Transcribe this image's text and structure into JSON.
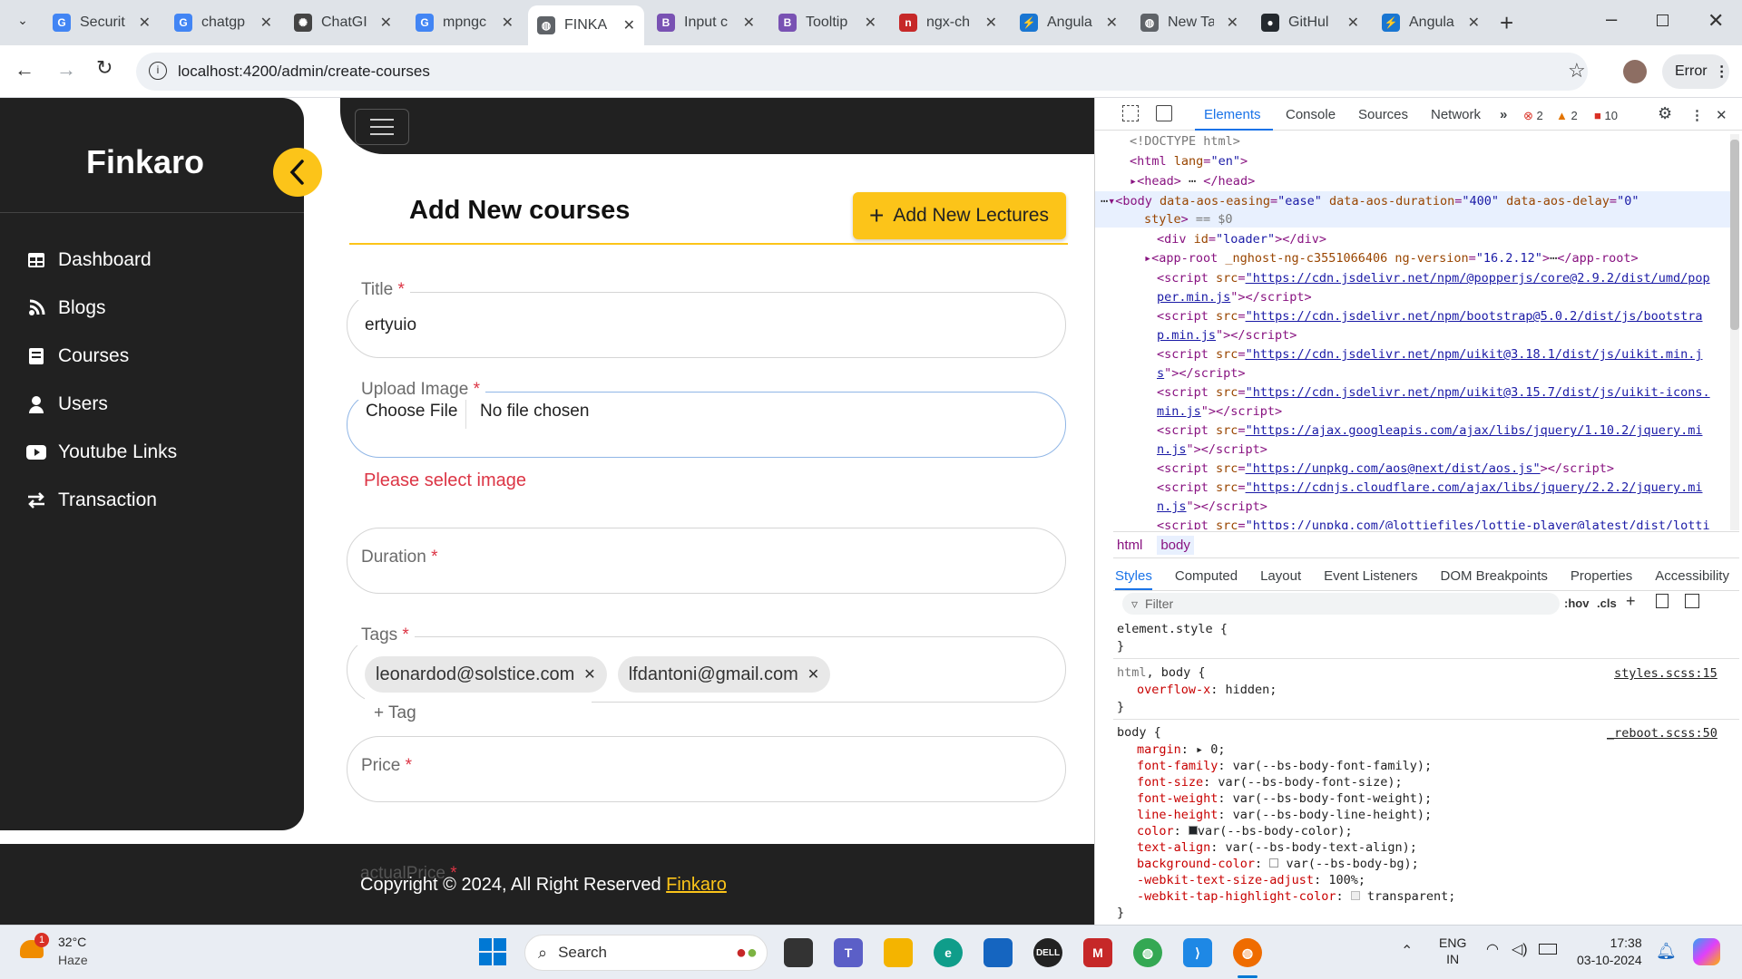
{
  "browser": {
    "tabs": [
      {
        "label": "Securit",
        "fav": "G",
        "color": "#4285f4",
        "active": false
      },
      {
        "label": "chatgp",
        "fav": "G",
        "color": "#4285f4",
        "active": false
      },
      {
        "label": "ChatGI",
        "fav": "✺",
        "color": "#444",
        "active": false
      },
      {
        "label": "mpngc",
        "fav": "G",
        "color": "#4285f4",
        "active": false
      },
      {
        "label": "FINKA",
        "fav": "◍",
        "color": "#5f6368",
        "active": true
      },
      {
        "label": "Input c",
        "fav": "B",
        "color": "#7952b3",
        "active": false
      },
      {
        "label": "Tooltip",
        "fav": "B",
        "color": "#7952b3",
        "active": false
      },
      {
        "label": "ngx-ch",
        "fav": "n",
        "color": "#c62828",
        "active": false
      },
      {
        "label": "Angula",
        "fav": "⚡",
        "color": "#1976d2",
        "active": false
      },
      {
        "label": "New Ta",
        "fav": "◍",
        "color": "#5f6368",
        "active": false
      },
      {
        "label": "GitHul",
        "fav": "●",
        "color": "#24292e",
        "active": false
      },
      {
        "label": "Angula",
        "fav": "⚡",
        "color": "#1976d2",
        "active": false
      }
    ],
    "url": "localhost:4200/admin/create-courses",
    "profile_label": "Error",
    "icons": [
      "tab-search-icon",
      "back-icon",
      "forward-icon",
      "reload-icon",
      "site-info-icon",
      "bookmark-star-icon",
      "avatar",
      "kebab-menu-icon",
      "new-tab-icon",
      "minimize-icon",
      "maximize-icon",
      "close-window-icon"
    ]
  },
  "sidebar": {
    "brand": "Finkaro",
    "items": [
      {
        "label": "Dashboard",
        "icon": "dashboard-icon"
      },
      {
        "label": "Blogs",
        "icon": "blogs-icon"
      },
      {
        "label": "Courses",
        "icon": "courses-icon"
      },
      {
        "label": "Users",
        "icon": "users-icon"
      },
      {
        "label": "Youtube Links",
        "icon": "youtube-icon"
      },
      {
        "label": "Transaction",
        "icon": "transaction-icon"
      }
    ]
  },
  "main": {
    "page_title": "Add New courses",
    "add_lectures_label": "Add New Lectures",
    "fields": {
      "title": {
        "label": "Title",
        "required": "*",
        "value": "ertyuio"
      },
      "upload": {
        "label": "Upload Image",
        "required": "*",
        "button": "Choose File",
        "status": "No file chosen",
        "error": "Please select image"
      },
      "duration": {
        "label": "Duration",
        "required": "*"
      },
      "tags": {
        "label": "Tags",
        "required": "*",
        "chips": [
          "leonardod@solstice.com",
          "lfdantoni@gmail.com"
        ],
        "add_label": "+ Tag"
      },
      "price": {
        "label": "Price",
        "required": "*"
      },
      "actual_price": {
        "label": "actualPrice",
        "required": "*"
      }
    },
    "footer": {
      "text": "Copyright © 2024, All Right Reserved ",
      "link": "Finkaro"
    }
  },
  "devtools": {
    "tabs": [
      "Elements",
      "Console",
      "Sources",
      "Network"
    ],
    "errors": "2",
    "warnings": "2",
    "issues": "10",
    "breadcrumb": [
      "html",
      "body"
    ],
    "lower_tabs": [
      "Styles",
      "Computed",
      "Layout",
      "Event Listeners",
      "DOM Breakpoints",
      "Properties",
      "Accessibility"
    ],
    "filter_placeholder": "Filter",
    "hov": ":hov",
    "cls": ".cls",
    "source1": "styles.scss:15",
    "source2": "_reboot.scss:50"
  },
  "taskbar": {
    "weather_temp": "32°C",
    "weather_desc": "Haze",
    "weather_badge": "1",
    "search_label": "Search",
    "lang1": "ENG",
    "lang2": "IN",
    "time": "17:38",
    "date": "03-10-2024"
  },
  "colors": {
    "accent": "#fcc419",
    "sidebar": "#212121",
    "error": "#dc3545",
    "footer_link": "#fcc419"
  }
}
